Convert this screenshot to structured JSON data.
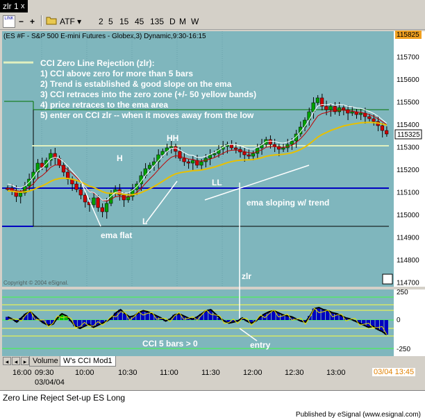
{
  "window": {
    "tab_title": "zlr 1",
    "close_glyph": "x"
  },
  "toolbar": {
    "link_label": "LINK",
    "symbol": "ATF",
    "intervals": [
      "2",
      "5",
      "15",
      "45",
      "135",
      "D",
      "M",
      "W"
    ]
  },
  "chart": {
    "header": "(ES #F - S&P 500 E-mini Futures - Globex,3) Dynamic,9:30-16:15",
    "price_ticks": [
      "115825",
      "115700",
      "115600",
      "115500",
      "115400",
      "115300",
      "115200",
      "115100",
      "115000",
      "114900",
      "114800",
      "114700"
    ],
    "current_price": "115325",
    "copyright": "Copyright © 2004 eSignal.",
    "cci_ticks": [
      "250",
      "0",
      "-250"
    ],
    "background": "#7fb6bd",
    "notes": {
      "title": "CCI Zero Line Rejection (zlr):",
      "rules": [
        "1) CCI above zero for more than 5 bars",
        "2) Trend is established & good slope on the ema",
        "3) CCI retraces into the zero zone (+/- 50 yellow bands)",
        "4) price retraces to the ema area",
        "5) enter on CCI zlr -- when it moves away from the low"
      ]
    },
    "annotations": {
      "h": "H",
      "hh": "HH",
      "l": "L",
      "ll": "LL",
      "ema_flat": "ema flat",
      "ema_sloping": "ema sloping w/ trend",
      "zlr": "zlr",
      "cci_5_bars": "CCI 5 bars > 0",
      "entry": "entry"
    }
  },
  "pane_tabs": [
    "Volume",
    "W's CCI Mod1"
  ],
  "time_axis": {
    "labels": [
      "16:00",
      "09:30",
      "10:00",
      "10:30",
      "11:00",
      "11:30",
      "12:00",
      "12:30",
      "13:00"
    ],
    "date": "03/04/04",
    "cursor_time": "03/04 13:45"
  },
  "footer": {
    "title": "Zero Line Reject Set-up ES Long",
    "published": "Published by eSignal (www.esignal.com)"
  }
}
